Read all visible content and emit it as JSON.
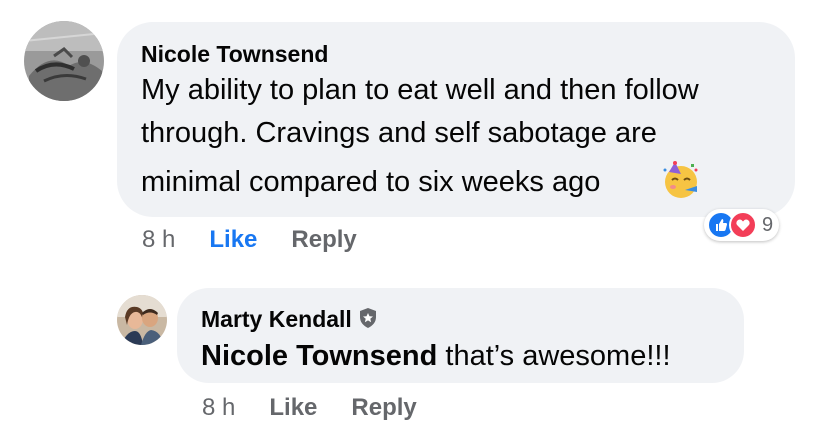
{
  "comment": {
    "author": "Nicole Townsend",
    "lines": [
      "My ability to plan to eat well and then follow",
      "through. Cravings and self sabotage are",
      "minimal compared to six weeks ago"
    ],
    "emoji": "partying-face",
    "time": "8 h",
    "like_label": "Like",
    "reply_label": "Reply",
    "reactions": [
      "like",
      "love"
    ],
    "reaction_count": "9"
  },
  "reply": {
    "author": "Marty Kendall",
    "badge": "shield-star-icon",
    "mention": "Nicole Townsend",
    "text": " that’s awesome!!!",
    "time": "8 h",
    "like_label": "Like",
    "reply_label": "Reply"
  },
  "colors": {
    "bubble": "#f0f2f5",
    "like_blue": "#1877f2",
    "love_red": "#f33e58",
    "meta_gray": "#65676b"
  }
}
